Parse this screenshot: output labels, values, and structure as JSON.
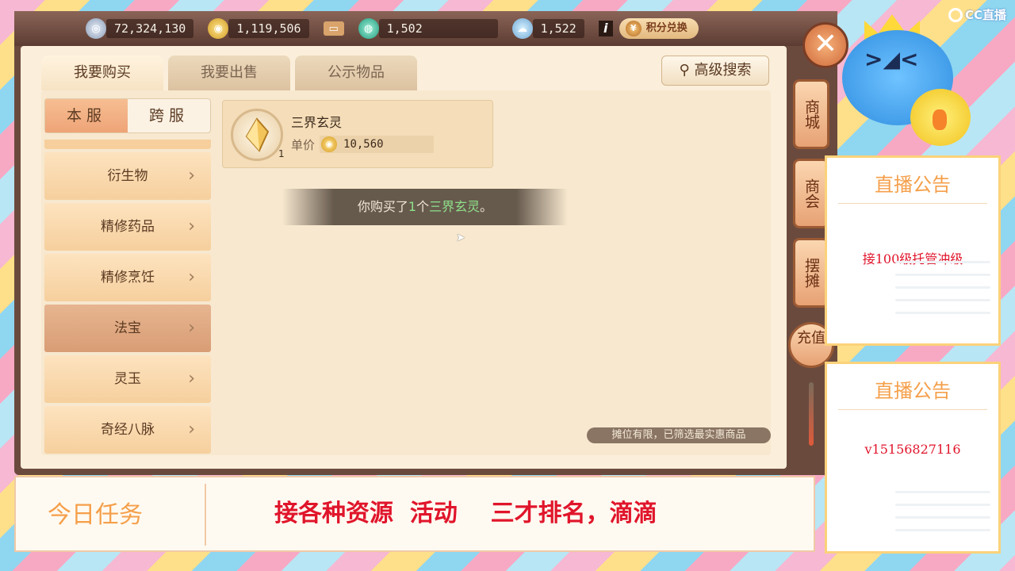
{
  "topbar": {
    "resources": [
      {
        "icon": "silver-coin-icon",
        "value": "72,324,130"
      },
      {
        "icon": "gold-coin-icon",
        "value": "1,119,506"
      },
      {
        "icon": "ticket-icon",
        "value": ""
      },
      {
        "icon": "jade-ring-icon",
        "value": "1,502"
      },
      {
        "icon": "cloud-token-icon",
        "value": "1,522"
      }
    ],
    "info_label": "i",
    "exchange_label": "积分兑换"
  },
  "tabs": [
    {
      "label": "我要购买",
      "active": true
    },
    {
      "label": "我要出售",
      "active": false
    },
    {
      "label": "公示物品",
      "active": false
    }
  ],
  "search_label": "高级搜索",
  "server": {
    "local": "本服",
    "cross": "跨服"
  },
  "categories": [
    {
      "label": "衍生物",
      "active": false
    },
    {
      "label": "精修药品",
      "active": false
    },
    {
      "label": "精修烹饪",
      "active": false
    },
    {
      "label": "法宝",
      "active": true
    },
    {
      "label": "灵玉",
      "active": false
    },
    {
      "label": "奇经八脉",
      "active": false
    }
  ],
  "item": {
    "name": "三界玄灵",
    "qty": "1",
    "price_label": "单价",
    "price": "10,560"
  },
  "toast": {
    "prefix": "你购买了",
    "count": "1",
    "unit": "个",
    "item": "三界玄灵",
    "suffix": "。"
  },
  "footer_tip": "摊位有限，已筛选最实惠商品",
  "rail": [
    "商城",
    "商会",
    "摆摊",
    "充值"
  ],
  "close_label": "✕",
  "taskbar": {
    "title": "今日任务",
    "text": "接各种资源  活动    三才排名，滴滴"
  },
  "sidebar": {
    "logo_text": "CC直播",
    "notice1": {
      "title": "直播公告",
      "body": "接100级托管冲级"
    },
    "notice2": {
      "title": "直播公告",
      "body": "v15156827116"
    }
  },
  "colors": {
    "accent": "#f59f4a",
    "alert_red": "#e0152b",
    "toast_highlight": "#8fe08a"
  }
}
